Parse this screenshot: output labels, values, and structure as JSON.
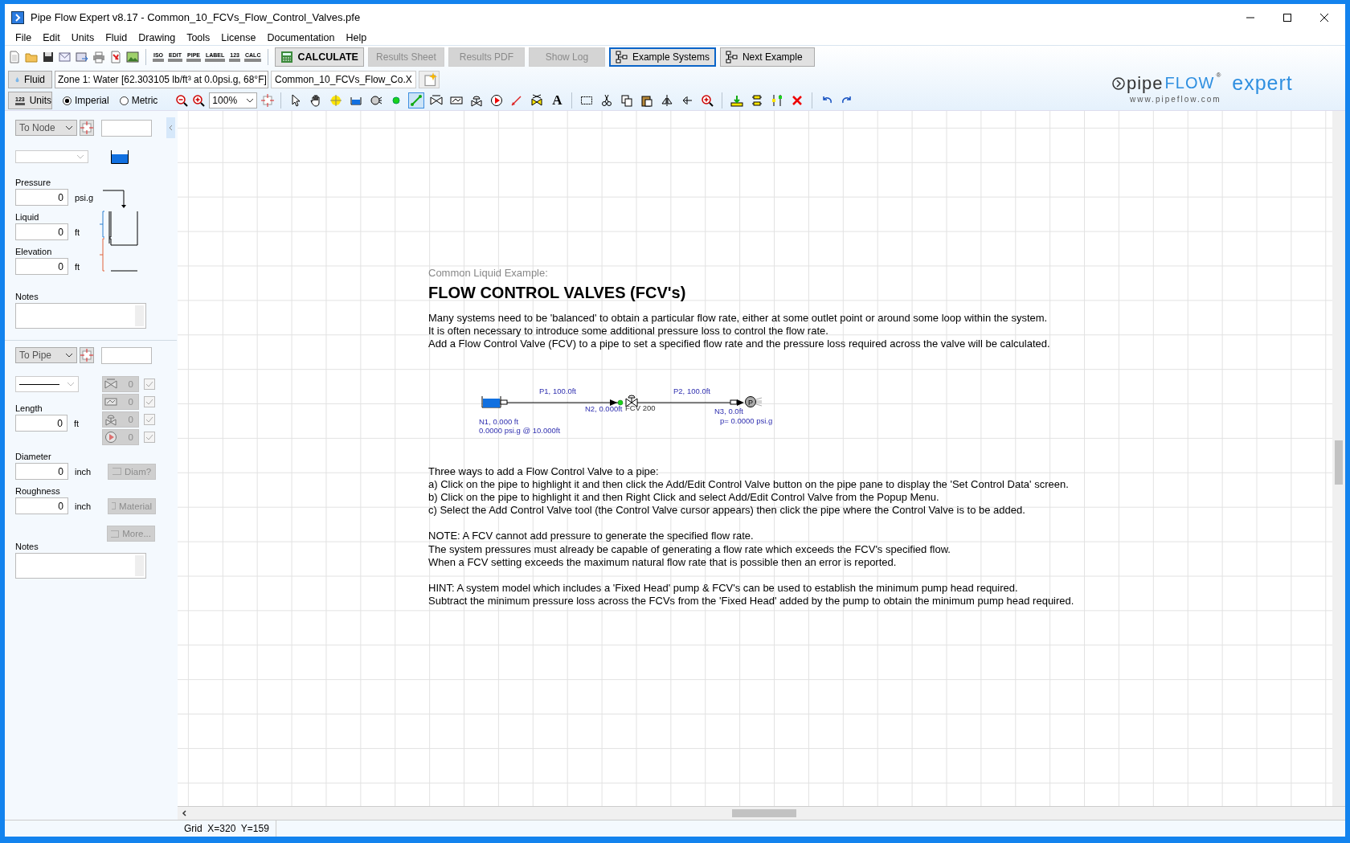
{
  "window": {
    "title": "Pipe Flow Expert v8.17 - Common_10_FCVs_Flow_Control_Valves.pfe"
  },
  "menu": [
    "File",
    "Edit",
    "Units",
    "Fluid",
    "Drawing",
    "Tools",
    "License",
    "Documentation",
    "Help"
  ],
  "toolbar": {
    "icon_labels": [
      "ISO",
      "EDIT",
      "PIPE",
      "LABEL",
      "123",
      "CALC"
    ],
    "buttons": [
      {
        "label": "CALCULATE",
        "kind": "calculate",
        "disabled": false,
        "focused": false
      },
      {
        "label": "Results Sheet",
        "kind": "plain",
        "disabled": true,
        "focused": false
      },
      {
        "label": "Results PDF",
        "kind": "plain",
        "disabled": true,
        "focused": false
      },
      {
        "label": "Show Log",
        "kind": "plain",
        "disabled": true,
        "focused": false
      },
      {
        "label": "Example Systems",
        "kind": "examples",
        "disabled": false,
        "focused": true
      },
      {
        "label": "Next Example",
        "kind": "next",
        "disabled": false,
        "focused": false
      }
    ]
  },
  "fluid_bar": {
    "fluid_button": "Fluid",
    "zone": "Zone 1: Water [62.303105 lb/ft³ at 0.0psi.g, 68°F]",
    "file_tab": "Common_10_FCVs_Flow_Co.X"
  },
  "units_bar": {
    "units_button": "Units",
    "units_icon_text": "123",
    "options": [
      {
        "label": "Imperial",
        "selected": true
      },
      {
        "label": "Metric",
        "selected": false
      }
    ],
    "zoom": "100%"
  },
  "drawing_tools": [
    {
      "selected": false
    },
    {
      "selected": false
    },
    {
      "selected": false
    },
    {
      "selected": false
    },
    {
      "selected": false
    },
    {
      "selected": false
    },
    {
      "selected": true
    },
    {
      "selected": false
    },
    {
      "selected": false
    },
    {
      "selected": false
    },
    {
      "selected": false
    },
    {
      "selected": false
    },
    {
      "selected": false
    }
  ],
  "text_tool_glyph": "A",
  "logo": {
    "brand_left": "pipe",
    "brand_right": "FLOW",
    "registered": "®",
    "product": "expert",
    "url": "www.pipeflow.com"
  },
  "node_panel": {
    "selector": "To Node",
    "pressure_label": "Pressure",
    "pressure": "0",
    "pressure_unit": "psi.g",
    "liquid_label": "Liquid",
    "liquid": "0",
    "liquid_unit": "ft",
    "elevation_label": "Elevation",
    "elevation": "0",
    "elevation_unit": "ft",
    "notes_label": "Notes"
  },
  "pipe_panel": {
    "selector": "To Pipe",
    "fittings": [
      {
        "kind": "valve",
        "count": "0",
        "checked": true
      },
      {
        "kind": "component",
        "count": "0",
        "checked": true
      },
      {
        "kind": "control_valve",
        "count": "0",
        "checked": true
      },
      {
        "kind": "pump",
        "count": "0",
        "checked": true
      }
    ],
    "length_label": "Length",
    "length": "0",
    "length_unit": "ft",
    "diameter_label": "Diameter",
    "diameter": "0",
    "diameter_unit": "inch",
    "diameter_button": "Diam?",
    "roughness_label": "Roughness",
    "roughness": "0",
    "roughness_unit": "inch",
    "material_button": "Material",
    "more_button": "More...",
    "notes_label": "Notes"
  },
  "canvas": {
    "subtitle": "Common Liquid Example:",
    "title": "FLOW CONTROL VALVES (FCV's)",
    "intro": [
      "Many systems need to be 'balanced' to obtain a particular flow rate, either at some outlet point or around some loop within the system.",
      "It is often necessary to introduce some additional pressure loss to control the flow rate.",
      "Add a Flow Control Valve (FCV) to a pipe to set a specified flow rate and the pressure loss required across the valve will be calculated."
    ],
    "diagram": {
      "pipe_1": "P1, 100.0ft",
      "pipe_2": "P2, 100.0ft",
      "node_1": "N1, 0.000 ft",
      "node_1_detail": "0.0000 psi.g @ 10.000ft",
      "node_2": "N2, 0.000ft",
      "valve": "FCV 200",
      "node_3": "N3, 0.0ft",
      "node_3_detail": "p= 0.0000 psi.g",
      "end_glyph": "P"
    },
    "ways": [
      "Three ways to add a Flow Control Valve to a pipe:",
      "a) Click on the pipe to highlight it and then click the Add/Edit Control Valve button on the pipe pane to display the 'Set Control Data' screen.",
      "b) Click on the pipe to highlight it and then Right Click and select Add/Edit Control Valve from the Popup Menu.",
      "c) Select the Add Control Valve tool (the Control Valve cursor appears) then click the pipe where the Control Valve is to be added."
    ],
    "note": [
      "NOTE: A FCV cannot add pressure to generate the specified flow rate.",
      "The system pressures must already be capable of generating a flow rate which exceeds the FCV's specified flow.",
      "When a FCV setting exceeds the maximum natural flow rate that is possible then an error is reported."
    ],
    "hint": [
      "HINT: A system model which includes a 'Fixed Head' pump & FCV's can be used to establish the minimum pump head required.",
      "Subtract the minimum pressure loss across the FCVs from the 'Fixed Head' added by the pump to obtain the minimum pump head required."
    ]
  },
  "status_bar": "Grid  X=320  Y=159"
}
